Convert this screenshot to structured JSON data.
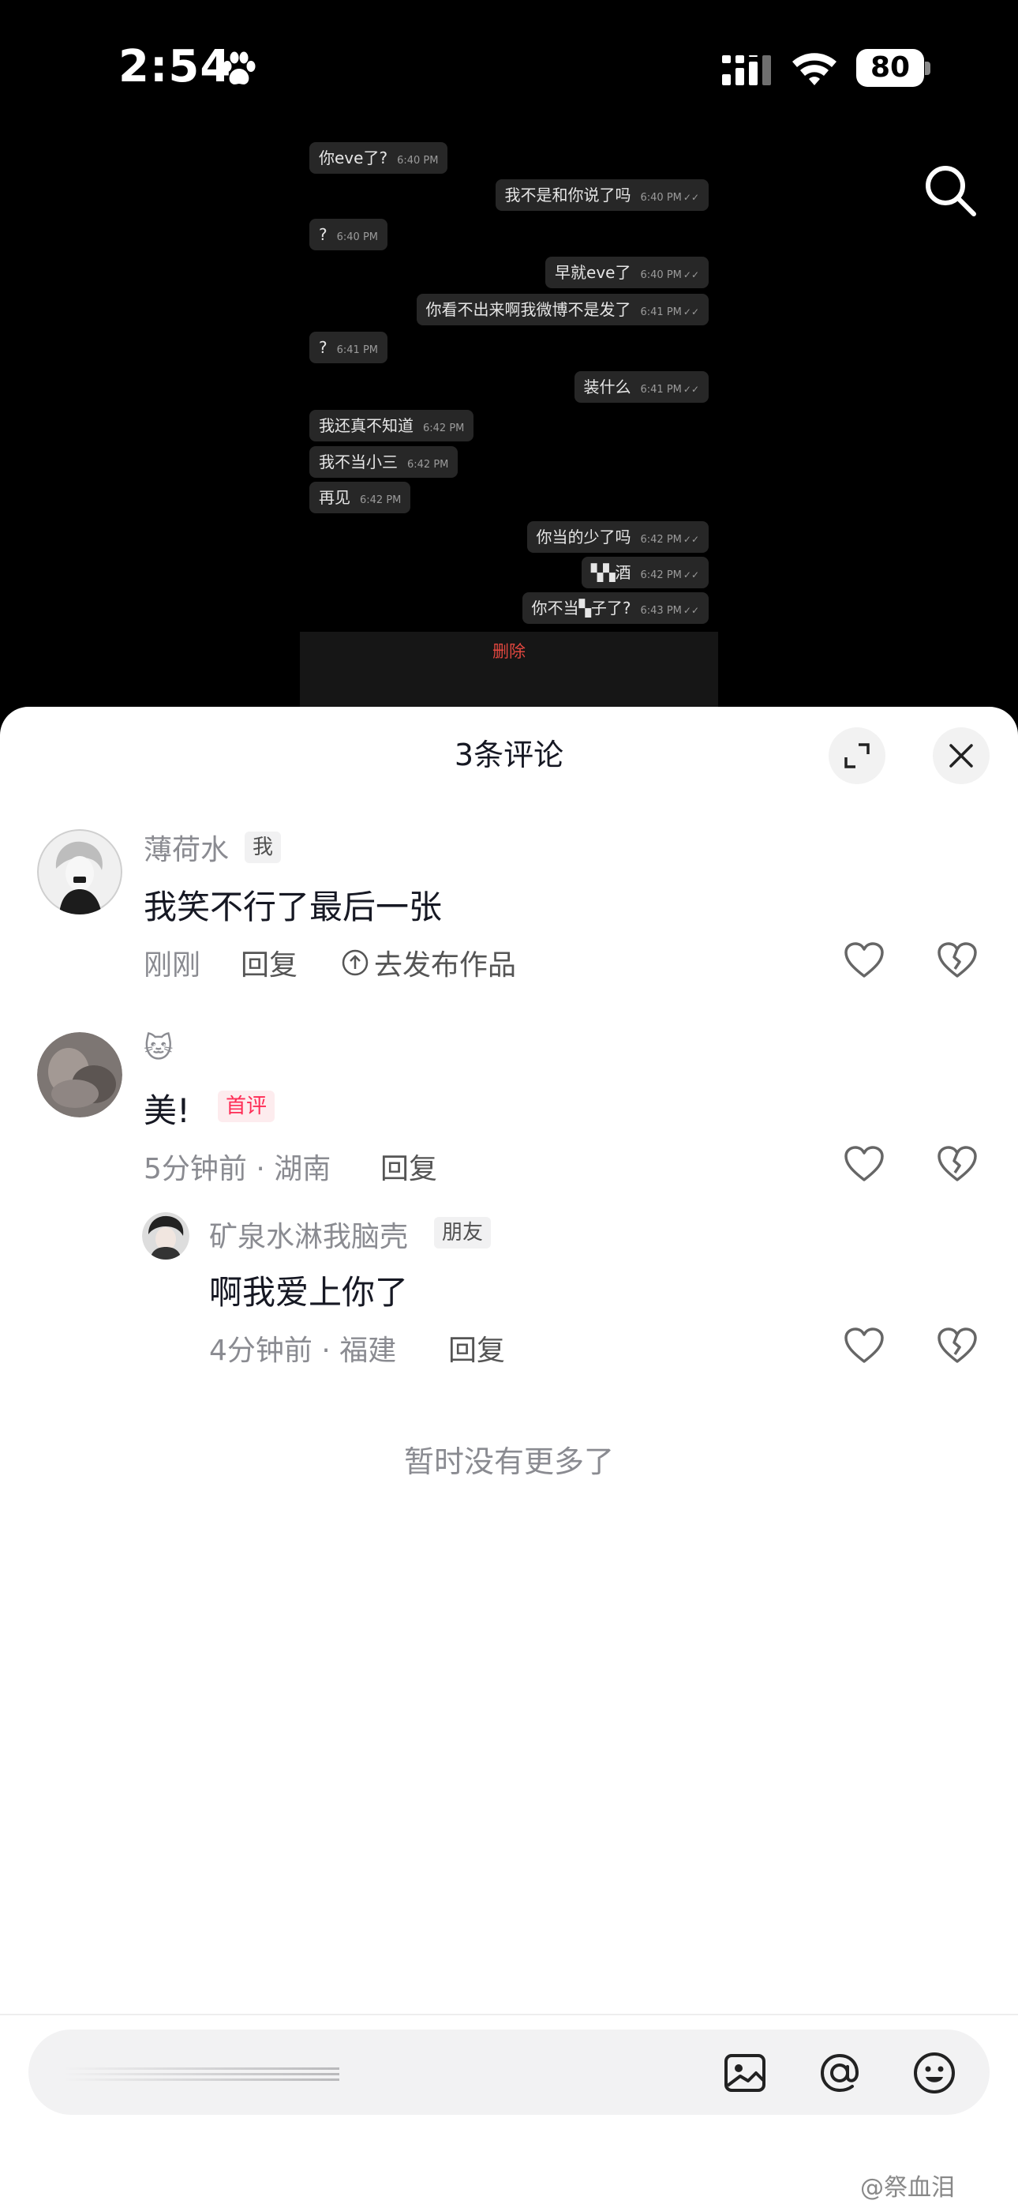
{
  "status_bar": {
    "time": "2:54",
    "battery": "80"
  },
  "chat_screenshot": {
    "messages": [
      {
        "side": "left",
        "text": "你eve了?",
        "time": "6:40 PM",
        "read": false
      },
      {
        "side": "right",
        "text": "我不是和你说了吗",
        "time": "6:40 PM",
        "read": true
      },
      {
        "side": "left",
        "text": "?",
        "time": "6:40 PM",
        "read": false
      },
      {
        "side": "right",
        "text": "早就eve了",
        "time": "6:40 PM",
        "read": true
      },
      {
        "side": "right",
        "text": "你看不出来啊我微博不是发了",
        "time": "6:41 PM",
        "read": true
      },
      {
        "side": "left",
        "text": "?",
        "time": "6:41 PM",
        "read": false
      },
      {
        "side": "right",
        "text": "装什么",
        "time": "6:41 PM",
        "read": true
      },
      {
        "side": "left",
        "text": "我还真不知道",
        "time": "6:42 PM",
        "read": false
      },
      {
        "side": "left",
        "text": "我不当小三",
        "time": "6:42 PM",
        "read": false
      },
      {
        "side": "left",
        "text": "再见",
        "time": "6:42 PM",
        "read": false
      },
      {
        "side": "right",
        "text": "你当的少了吗",
        "time": "6:42 PM",
        "read": true
      },
      {
        "side": "right",
        "text": "▚▚酒",
        "time": "6:42 PM",
        "read": true
      },
      {
        "side": "right",
        "text": "你不当▚子了?",
        "time": "6:43 PM",
        "read": true
      }
    ],
    "delete_label": "删除"
  },
  "sheet": {
    "title": "3条评论",
    "comments": [
      {
        "username": "薄荷水",
        "tag": "我",
        "content": "我笑不行了最后一张",
        "meta": "刚刚",
        "reply_label": "回复",
        "publish_label": "去发布作品"
      },
      {
        "username": "🐱",
        "content": "美!",
        "badge": "首评",
        "meta": "5分钟前 · 湖南",
        "reply_label": "回复"
      },
      {
        "username": "矿泉水淋我脑壳",
        "tag": "朋友",
        "content": "啊我爱上你了",
        "meta": "4分钟前 · 福建",
        "reply_label": "回复"
      }
    ],
    "end_note": "暂时没有更多了"
  },
  "watermark": "@祭血泪",
  "icons": {
    "status": [
      "paw-icon",
      "signal-icon",
      "wifi-icon"
    ],
    "top": [
      "search-icon"
    ],
    "sheet": [
      "expand-icon",
      "close-icon",
      "like-heart-icon",
      "dislike-broken-heart-icon",
      "upload-icon"
    ],
    "input": [
      "image-icon",
      "at-mention-icon",
      "emoji-icon"
    ]
  }
}
